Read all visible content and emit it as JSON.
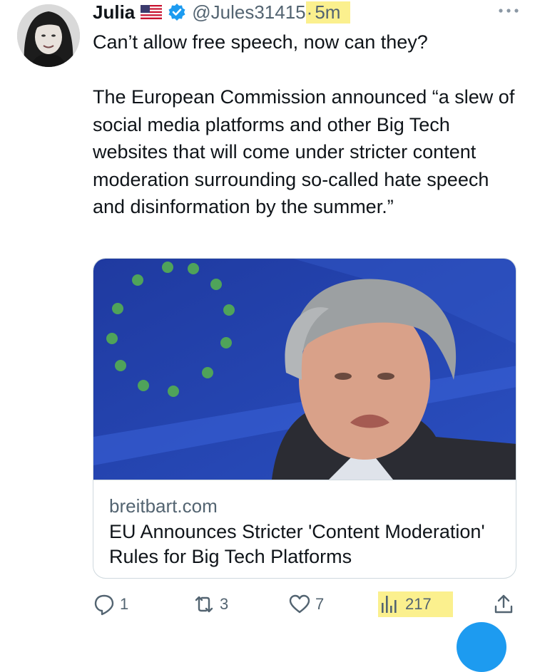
{
  "tweet": {
    "author_name": "Julia",
    "handle": "@Jules31415",
    "separator": "·",
    "time": "5m",
    "paragraph_1": "Can’t allow free speech, now can they?",
    "paragraph_2": "The European Commission announced “a slew of social media platforms and other Big Tech websites that will come under stricter content moderation surrounding so-called hate speech and disinformation by the summer.”"
  },
  "card": {
    "domain": "breitbart.com",
    "title": "EU Announces Stricter 'Content Moderation' Rules for Big Tech Platforms"
  },
  "actions": {
    "replies": "1",
    "reposts": "3",
    "likes": "7",
    "views": "217"
  },
  "icons": {
    "flag": "us-flag-icon",
    "verified": "verified-badge-icon",
    "more": "more-horizontal-icon",
    "reply": "reply-icon",
    "repost": "repost-icon",
    "like": "heart-icon",
    "views": "views-chart-icon",
    "share": "share-icon"
  },
  "colors": {
    "text": "#0f1419",
    "secondary": "#536471",
    "highlight": "#fbf08e",
    "verified": "#1d9bf0",
    "border": "#cfd9de"
  }
}
